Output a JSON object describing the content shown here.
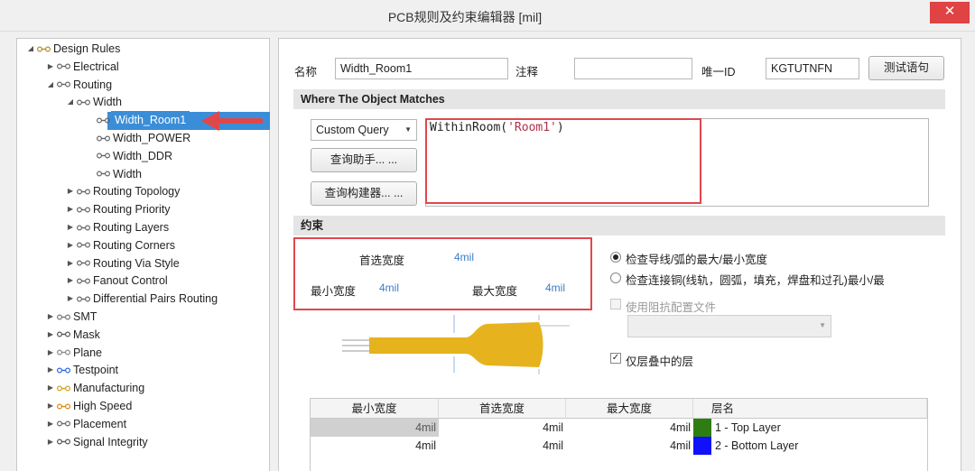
{
  "window": {
    "title": "PCB规则及约束编辑器 [mil]",
    "close_glyph": "✕"
  },
  "tree": {
    "items": [
      {
        "label": "Design Rules",
        "expanded": true,
        "icon": "design-rules-icon"
      },
      {
        "label": "Electrical",
        "expanded": false,
        "icon": "electrical-icon"
      },
      {
        "label": "Routing",
        "expanded": true,
        "icon": "routing-icon"
      },
      {
        "label": "Width",
        "expanded": true,
        "icon": "width-rule-icon"
      },
      {
        "label": "Width_Room1",
        "selected": true,
        "icon": "width-rule-icon"
      },
      {
        "label": "Width_POWER",
        "icon": "width-rule-icon"
      },
      {
        "label": "Width_DDR",
        "icon": "width-rule-icon"
      },
      {
        "label": "Width",
        "icon": "width-rule-icon"
      },
      {
        "label": "Routing Topology",
        "expanded": false,
        "icon": "routing-topology-icon"
      },
      {
        "label": "Routing Priority",
        "expanded": false,
        "icon": "routing-priority-icon"
      },
      {
        "label": "Routing Layers",
        "expanded": false,
        "icon": "routing-layers-icon"
      },
      {
        "label": "Routing Corners",
        "expanded": false,
        "icon": "routing-corners-icon"
      },
      {
        "label": "Routing Via Style",
        "expanded": false,
        "icon": "routing-via-style-icon"
      },
      {
        "label": "Fanout Control",
        "expanded": false,
        "icon": "fanout-control-icon"
      },
      {
        "label": "Differential Pairs Routing",
        "expanded": false,
        "icon": "differential-pairs-icon"
      },
      {
        "label": "SMT",
        "expanded": false,
        "icon": "smt-icon"
      },
      {
        "label": "Mask",
        "expanded": false,
        "icon": "mask-icon"
      },
      {
        "label": "Plane",
        "expanded": false,
        "icon": "plane-icon"
      },
      {
        "label": "Testpoint",
        "expanded": false,
        "icon": "testpoint-icon"
      },
      {
        "label": "Manufacturing",
        "expanded": false,
        "icon": "manufacturing-icon"
      },
      {
        "label": "High Speed",
        "expanded": false,
        "icon": "high-speed-icon"
      },
      {
        "label": "Placement",
        "expanded": false,
        "icon": "placement-icon"
      },
      {
        "label": "Signal Integrity",
        "expanded": false,
        "icon": "signal-integrity-icon"
      }
    ]
  },
  "rule": {
    "name_label": "名称",
    "name_value": "Width_Room1",
    "comment_label": "注释",
    "comment_value": "",
    "id_label": "唯一ID",
    "id_value": "KGTUTNFN",
    "test_button": "测试语句"
  },
  "where": {
    "section_title": "Where The Object Matches",
    "query_type": "Custom Query",
    "query_helper_button": "查询助手... ...",
    "query_builder_button": "查询构建器... ...",
    "query_func": "WithinRoom(",
    "query_arg": "'Room1'",
    "query_close": ")"
  },
  "constraints": {
    "section_title": "约束",
    "preferred_label": "首选宽度",
    "preferred_value": "4mil",
    "min_label": "最小宽度",
    "min_value": "4mil",
    "max_label": "最大宽度",
    "max_value": "4mil",
    "radio1": "检查导线/弧的最大/最小宽度",
    "radio2": "检查连接铜(线轨，圆弧，填充，焊盘和过孔)最小/最",
    "impedance_check": "使用阻抗配置文件",
    "stack_check": "仅层叠中的层",
    "selected_radio": 1
  },
  "layer_table": {
    "headers": [
      "最小宽度",
      "首选宽度",
      "最大宽度",
      "层名"
    ],
    "rows": [
      {
        "min": "4mil",
        "pref": "4mil",
        "max": "4mil",
        "layer": "1 - Top Layer",
        "color": "#2e7d13"
      },
      {
        "min": "4mil",
        "pref": "4mil",
        "max": "4mil",
        "layer": "2 - Bottom Layer",
        "color": "#1010ff"
      }
    ]
  },
  "colors": {
    "selection": "#3a8ed8",
    "highlight": "#e0474c",
    "trace": "#e6b31e"
  }
}
